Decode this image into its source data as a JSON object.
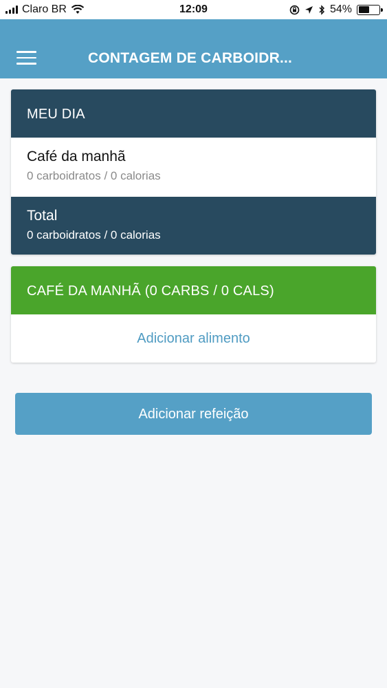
{
  "status_bar": {
    "carrier": "Claro BR",
    "time": "12:09",
    "battery_percent": "54%",
    "battery_level": 0.54
  },
  "header": {
    "title": "CONTAGEM DE CARBOIDR...",
    "color": "#55a0c6"
  },
  "day_card": {
    "title": "MEU DIA",
    "meals": [
      {
        "name": "Café da manhã",
        "summary": "0 carboidratos / 0 calorias"
      }
    ],
    "total": {
      "label": "Total",
      "summary": "0 carboidratos / 0 calorias"
    }
  },
  "meal_card": {
    "title": "CAFÉ DA MANHÃ (0 CARBS / 0 CALS)",
    "add_food_label": "Adicionar alimento",
    "color": "#4aa52b"
  },
  "add_meal_label": "Adicionar refeição"
}
